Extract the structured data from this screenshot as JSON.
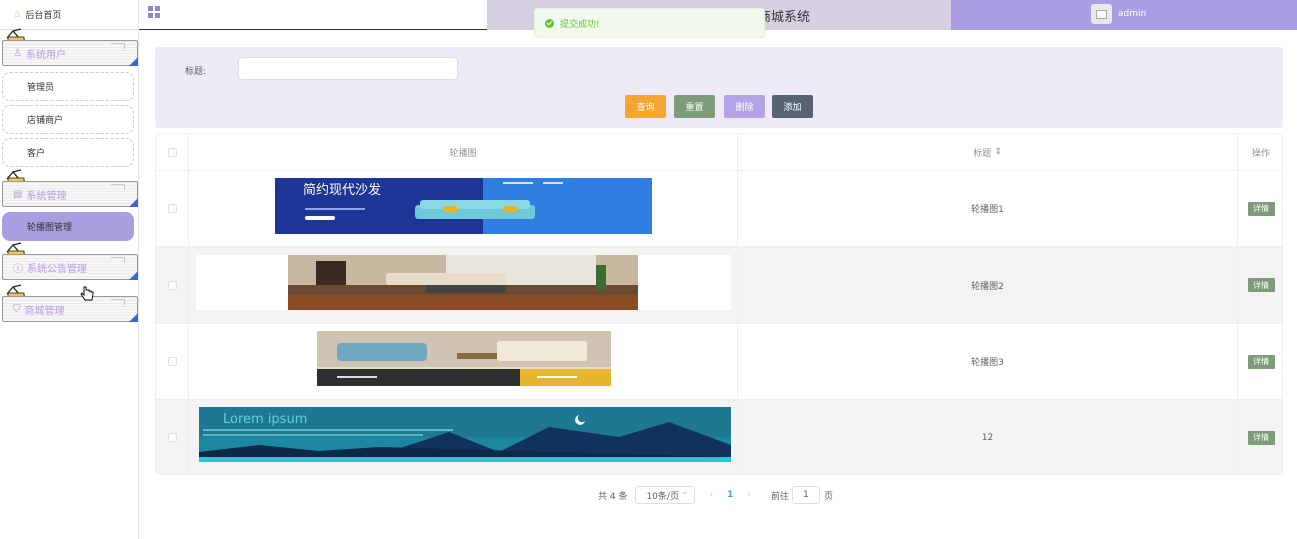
{
  "sidebar": {
    "home_label": "后台首页",
    "groups": [
      {
        "label": "系统用户",
        "icon": "user-icon",
        "items": [
          "管理员",
          "店铺商户",
          "客户"
        ]
      },
      {
        "label": "系统管理",
        "icon": "document-icon",
        "items": [
          "轮播图管理"
        ]
      },
      {
        "label": "系统公告管理",
        "icon": "info-icon",
        "items": []
      },
      {
        "label": "商城管理",
        "icon": "cart-icon",
        "items": []
      }
    ]
  },
  "header": {
    "title": "欢迎使用在线二手家具商城系统",
    "username": "admin"
  },
  "toast": {
    "message": "提交成功!"
  },
  "search": {
    "title_label": "标题:",
    "title_value": "",
    "buttons": {
      "query": "查询",
      "reset": "重置",
      "delete": "删除",
      "add": "添加"
    }
  },
  "table": {
    "columns": [
      "轮播图",
      "标题",
      "操作"
    ],
    "rows": [
      {
        "title": "轮播图1",
        "action": "详情",
        "image_text": "简约现代沙发"
      },
      {
        "title": "轮播图2",
        "action": "详情"
      },
      {
        "title": "轮播图3",
        "action": "详情"
      },
      {
        "title": "12",
        "action": "详情",
        "image_text": "Lorem ipsum"
      }
    ]
  },
  "pagination": {
    "total": "共 4 条",
    "page_size": "10条/页",
    "current_page": "1",
    "goto_prefix": "前往",
    "goto_value": "1",
    "goto_suffix": "页"
  },
  "colors": {
    "accent": "#ab9de4",
    "header_mid": "#d6d0e2",
    "query": "#f6a531",
    "reset": "#7e9c7a",
    "delete": "#b2a3e5",
    "add": "#586473"
  }
}
